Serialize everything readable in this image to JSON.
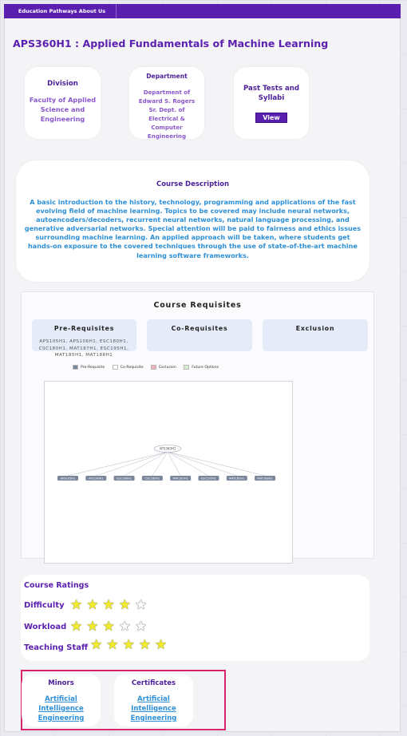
{
  "nav": {
    "brand": "Education Pathways About Us"
  },
  "course": {
    "title": "APS360H1 : Applied Fundamentals of Machine Learning"
  },
  "info": {
    "division_title": "Division",
    "division_value": "Faculty of Applied Science and Engineering",
    "department_title": "Department",
    "department_value": "Department of Edward S. Rogers Sr. Dept. of Electrical & Computer Engineering",
    "tests_title": "Past Tests and Syllabi",
    "view_label": "View"
  },
  "description": {
    "title": "Course Description",
    "text": "A basic introduction to the history, technology, programming and applications of the fast evolving field of machine learning. Topics to be covered may include neural networks, autoencoders/decoders, recurrent neural networks, natural language processing, and generative adversarial networks. Special attention will be paid to fairness and ethics issues surrounding machine learning. An applied approach will be taken, where students get hands-on exposure to the covered techniques through the use of state-of-the-art machine learning software frameworks."
  },
  "requisites": {
    "heading": "Course Requisites",
    "prereq_title": "Pre-Requisites",
    "coreq_title": "Co-Requisites",
    "exclusion_title": "Exclusion",
    "prereq_list": "APS105H1, APS106H1, ESC180H1, CSC180H1, MAT187H1, ESC195H1, MAT185H1, MAT188H1",
    "legend": [
      {
        "label": "Pre-Requisite",
        "color": "#7a869c"
      },
      {
        "label": "Co-Requisite",
        "color": "#ffffff"
      },
      {
        "label": "Exclusion",
        "color": "#eab2b9"
      },
      {
        "label": "Future Options",
        "color": "#d5ecd0"
      }
    ],
    "graph": {
      "center_node": "APS360H1",
      "nodes": [
        "APS105H1",
        "APS106H1",
        "ESC180H1",
        "CSC180H1",
        "MAT187H1",
        "ESC195H1",
        "MAT185H1",
        "MAT188H1"
      ]
    }
  },
  "ratings": {
    "title": "Course Ratings",
    "items": [
      {
        "label": "Difficulty",
        "stars": 4
      },
      {
        "label": "Workload",
        "stars": 3
      },
      {
        "label": "Teaching Staff",
        "stars": 5
      }
    ],
    "max": 5
  },
  "programs": {
    "minors_title": "Minors",
    "minors_link": "Artificial Intelligence Engineering",
    "certificates_title": "Certificates",
    "certificates_link": "Artificial Intelligence Engineering"
  },
  "colors": {
    "brand": "#5b1fb0",
    "link": "#2e8fd6",
    "highlight_border": "#d6256d",
    "star": "#f2ec2d"
  }
}
